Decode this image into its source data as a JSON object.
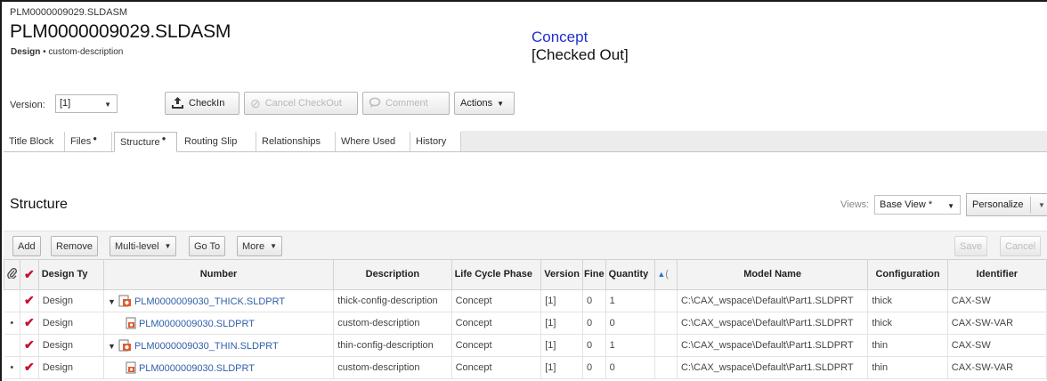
{
  "header": {
    "breadcrumb": "PLM0000009029.SLDASM",
    "title": "PLM0000009029.SLDASM",
    "type": "Design",
    "separator": "•",
    "description": "custom-description",
    "state": "Concept",
    "checkout_status": "[Checked Out]",
    "state_color": "#1f2ed0"
  },
  "toolbar": {
    "version_label": "Version:",
    "version_value": "[1]",
    "checkin_label": "CheckIn",
    "cancel_checkout_label": "Cancel CheckOut",
    "comment_label": "Comment",
    "actions_label": "Actions"
  },
  "tabs": [
    {
      "label": "Title Block",
      "dot": ""
    },
    {
      "label": "Files",
      "dot": "●"
    },
    {
      "label": "Structure",
      "dot": "●"
    },
    {
      "label": "Routing Slip",
      "dot": ""
    },
    {
      "label": "Relationships",
      "dot": ""
    },
    {
      "label": "Where Used",
      "dot": ""
    },
    {
      "label": "History",
      "dot": ""
    }
  ],
  "structure": {
    "title": "Structure",
    "views_label": "Views:",
    "view_value": "Base View *",
    "personalize_label": "Personalize",
    "buttons": {
      "add": "Add",
      "remove": "Remove",
      "multilevel": "Multi-level",
      "goto": "Go To",
      "more": "More",
      "save": "Save",
      "cancel": "Cancel"
    },
    "columns": {
      "design_type": "Design Ty",
      "number": "Number",
      "description": "Description",
      "lifecycle": "Life Cycle Phase",
      "version": "Version",
      "find": "Fine",
      "quantity": "Quantity",
      "sort_col": "(",
      "model_name": "Model Name",
      "configuration": "Configuration",
      "identifier": "Identifier"
    },
    "rows": [
      {
        "bullet": "",
        "design_type": "Design",
        "number": "PLM0000009030_THICK.SLDPRT",
        "description": "thick-config-description",
        "lifecycle": "Concept",
        "version": "[1]",
        "find": "0",
        "quantity": "1",
        "model_name": "C:\\CAX_wspace\\Default\\Part1.SLDPRT",
        "configuration": "thick",
        "identifier": "CAX-SW"
      },
      {
        "bullet": "•",
        "design_type": "Design",
        "number": "PLM0000009030.SLDPRT",
        "description": "custom-description",
        "lifecycle": "Concept",
        "version": "[1]",
        "find": "0",
        "quantity": "0",
        "model_name": "C:\\CAX_wspace\\Default\\Part1.SLDPRT",
        "configuration": "thick",
        "identifier": "CAX-SW-VAR"
      },
      {
        "bullet": "",
        "design_type": "Design",
        "number": "PLM0000009030_THIN.SLDPRT",
        "description": "thin-config-description",
        "lifecycle": "Concept",
        "version": "[1]",
        "find": "0",
        "quantity": "1",
        "model_name": "C:\\CAX_wspace\\Default\\Part1.SLDPRT",
        "configuration": "thin",
        "identifier": "CAX-SW"
      },
      {
        "bullet": "•",
        "design_type": "Design",
        "number": "PLM0000009030.SLDPRT",
        "description": "custom-description",
        "lifecycle": "Concept",
        "version": "[1]",
        "find": "0",
        "quantity": "0",
        "model_name": "C:\\CAX_wspace\\Default\\Part1.SLDPRT",
        "configuration": "thin",
        "identifier": "CAX-SW-VAR"
      }
    ]
  },
  "icons": {
    "checkin": "upload-tray-icon",
    "cancel": "cancel-circle-icon",
    "comment": "speech-bubble-icon",
    "attachment": "paperclip-icon",
    "check": "checkmark-icon",
    "assembly": "assembly-icon",
    "part": "part-icon"
  }
}
